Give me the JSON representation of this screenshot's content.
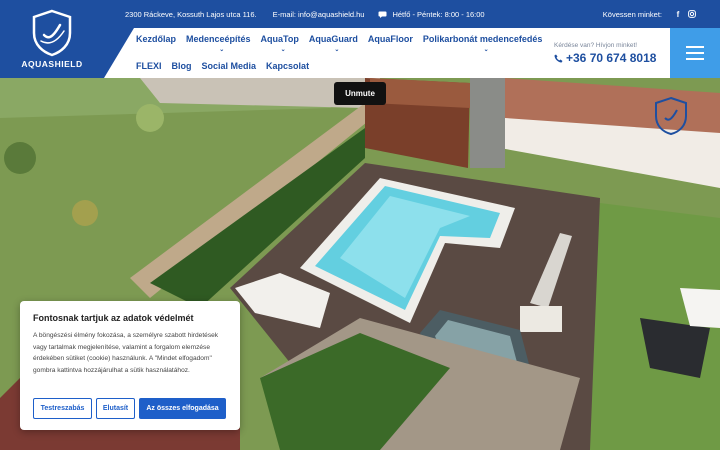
{
  "brand": {
    "name": "AQUASHIELD",
    "color": "#1e4fa0",
    "accent": "#3f9de8"
  },
  "topbar": {
    "address": "2300 Ráckeve, Kossuth Lajos utca 116.",
    "email": "E-mail: info@aquashield.hu",
    "hours": "Hétfő - Péntek: 8:00 - 16:00",
    "follow": "Kövessen minket:",
    "socials": [
      "facebook-icon",
      "instagram-icon"
    ]
  },
  "nav": {
    "row1": [
      {
        "label": "Kezdőlap",
        "dropdown": false
      },
      {
        "label": "Medenceépítés",
        "dropdown": true
      },
      {
        "label": "AquaTop",
        "dropdown": true
      },
      {
        "label": "AquaGuard",
        "dropdown": true
      },
      {
        "label": "AquaFloor",
        "dropdown": false
      },
      {
        "label": "Polikarbonát medencefedés",
        "dropdown": true
      }
    ],
    "row2": [
      {
        "label": "FLEXI",
        "dropdown": false
      },
      {
        "label": "Blog",
        "dropdown": false
      },
      {
        "label": "Social Media",
        "dropdown": false
      },
      {
        "label": "Kapcsolat",
        "dropdown": false
      }
    ]
  },
  "contact": {
    "question": "Kérdése van? Hívjon minket!",
    "phone": "+36 70 674 8018"
  },
  "video": {
    "unmute_label": "Unmute"
  },
  "cookie": {
    "title": "Fontosnak tartjuk az adatok védelmét",
    "body": "A böngészési élmény fokozása, a személyre szabott hirdetések vagy tartalmak megjelenítése, valamint a forgalom elemzése érdekében sütiket (cookie) használunk. A \"Mindet elfogadom\" gombra kattintva hozzájárulhat a sütik használatához.",
    "settings_label": "Testreszabás",
    "reject_label": "Elutasít",
    "accept_label": "Az összes elfogadása"
  }
}
